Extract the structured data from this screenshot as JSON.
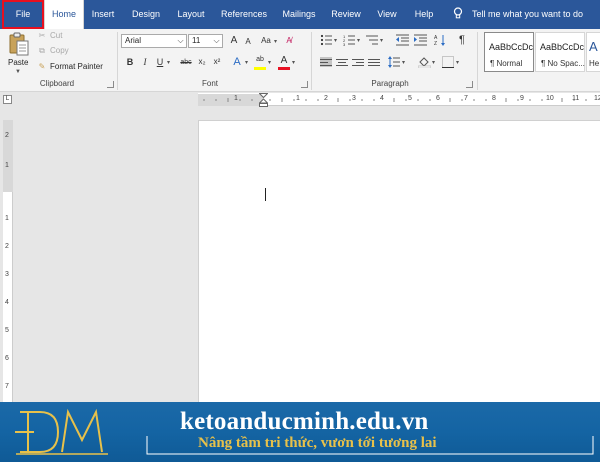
{
  "tabs": [
    {
      "label": "File"
    },
    {
      "label": "Home"
    },
    {
      "label": "Insert"
    },
    {
      "label": "Design"
    },
    {
      "label": "Layout"
    },
    {
      "label": "References"
    },
    {
      "label": "Mailings"
    },
    {
      "label": "Review"
    },
    {
      "label": "View"
    },
    {
      "label": "Help"
    }
  ],
  "tell_me": "Tell me what you want to do",
  "clipboard": {
    "paste": "Paste",
    "cut": "Cut",
    "copy": "Copy",
    "format_painter": "Format Painter",
    "group": "Clipboard"
  },
  "font": {
    "name": "Arial",
    "size": "11",
    "group": "Font",
    "bold": "B",
    "italic": "I",
    "underline": "U",
    "strike": "abc",
    "subscript": "x₂",
    "superscript": "x²",
    "grow": "A",
    "shrink": "A",
    "case": "Aa",
    "effects": "A",
    "highlight": "ab",
    "color": "A"
  },
  "paragraph": {
    "group": "Paragraph",
    "pilcrow": "¶"
  },
  "styles": [
    {
      "preview": "AaBbCcDc",
      "name": "¶ Normal"
    },
    {
      "preview": "AaBbCcDc",
      "name": "¶ No Spac..."
    },
    {
      "preview": "A",
      "name": "He"
    }
  ],
  "ruler": {
    "h_numbers": [
      "1",
      "1",
      "2",
      "3",
      "4",
      "5",
      "6",
      "7",
      "8",
      "9",
      "10",
      "11",
      "12"
    ],
    "v_numbers": [
      "2",
      "1",
      "1",
      "2",
      "3",
      "4",
      "5",
      "6",
      "7"
    ],
    "corner": "L"
  },
  "banner": {
    "logo": "ĐM",
    "site": "ketoanducminh.edu.vn",
    "tagline": "Nâng tầm tri thức, vươn tới tương lai"
  },
  "colors": {
    "tabbar": "#2b579a",
    "file_highlight": "#e8101f",
    "banner": "#1464a3",
    "tagline": "#e8c14a",
    "font_color_bar": "#e81123",
    "highlight_bar": "#ffff00"
  }
}
